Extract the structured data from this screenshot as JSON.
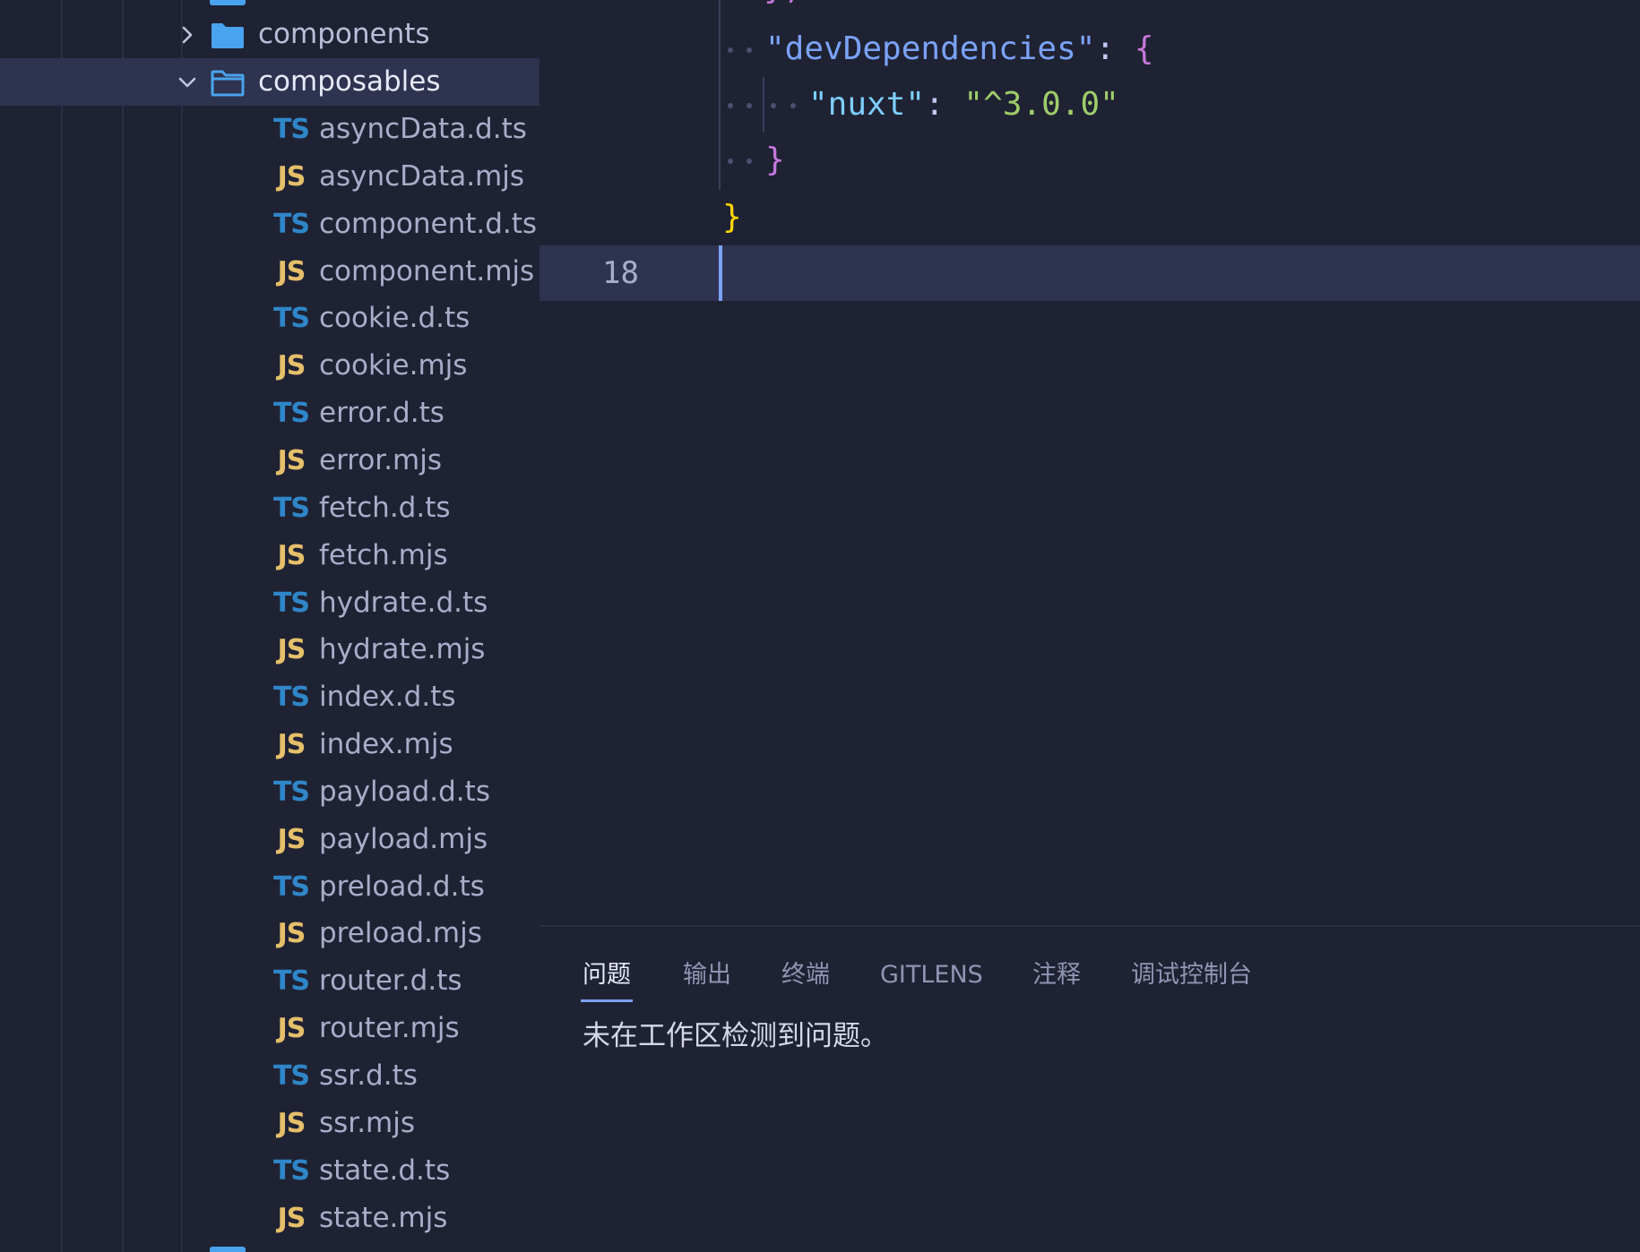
{
  "explorer": {
    "folders": [
      {
        "label": "components",
        "expanded": false
      },
      {
        "label": "composables",
        "expanded": true,
        "selected": true
      }
    ],
    "files": [
      {
        "badge": "TS",
        "label": "asyncData.d.ts"
      },
      {
        "badge": "JS",
        "label": "asyncData.mjs"
      },
      {
        "badge": "TS",
        "label": "component.d.ts"
      },
      {
        "badge": "JS",
        "label": "component.mjs"
      },
      {
        "badge": "TS",
        "label": "cookie.d.ts"
      },
      {
        "badge": "JS",
        "label": "cookie.mjs"
      },
      {
        "badge": "TS",
        "label": "error.d.ts"
      },
      {
        "badge": "JS",
        "label": "error.mjs"
      },
      {
        "badge": "TS",
        "label": "fetch.d.ts"
      },
      {
        "badge": "JS",
        "label": "fetch.mjs"
      },
      {
        "badge": "TS",
        "label": "hydrate.d.ts"
      },
      {
        "badge": "JS",
        "label": "hydrate.mjs"
      },
      {
        "badge": "TS",
        "label": "index.d.ts"
      },
      {
        "badge": "JS",
        "label": "index.mjs"
      },
      {
        "badge": "TS",
        "label": "payload.d.ts"
      },
      {
        "badge": "JS",
        "label": "payload.mjs"
      },
      {
        "badge": "TS",
        "label": "preload.d.ts"
      },
      {
        "badge": "JS",
        "label": "preload.mjs"
      },
      {
        "badge": "TS",
        "label": "router.d.ts"
      },
      {
        "badge": "JS",
        "label": "router.mjs"
      },
      {
        "badge": "TS",
        "label": "ssr.d.ts"
      },
      {
        "badge": "JS",
        "label": "ssr.mjs"
      },
      {
        "badge": "TS",
        "label": "state.d.ts"
      },
      {
        "badge": "JS",
        "label": "state.mjs"
      }
    ]
  },
  "editor": {
    "lines": {
      "dev_key": "\"devDependencies\"",
      "dev_colon": ":",
      "dev_open": "{",
      "nuxt_key": "\"nuxt\"",
      "nuxt_colon": ":",
      "nuxt_value": "\"^3.0.0\"",
      "inner_close": "}",
      "outer_close": "}"
    },
    "current_line_number": "18"
  },
  "panel": {
    "tabs": [
      "问题",
      "输出",
      "终端",
      "GITLENS",
      "注释",
      "调试控制台"
    ],
    "active_tab": "问题",
    "message": "未在工作区检测到问题。"
  },
  "colors": {
    "background": "#1f2233",
    "selection": "#2e3350",
    "accent": "#7aa2f7",
    "ts_badge": "#2f86c9",
    "js_badge": "#e5bf6a",
    "folder": "#4aa3ee"
  }
}
